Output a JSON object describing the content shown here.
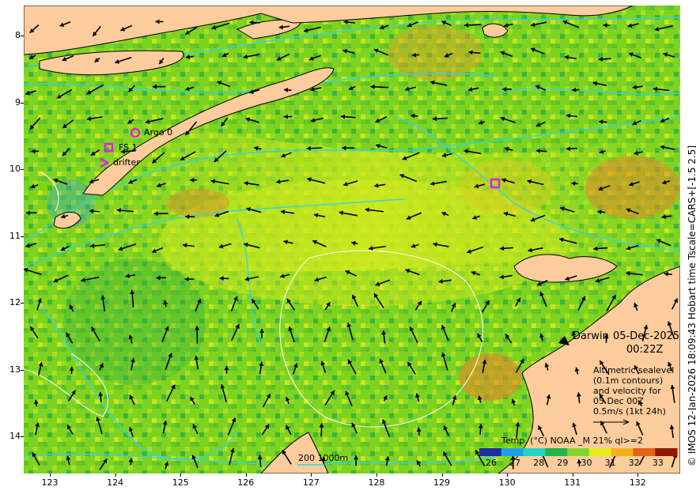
{
  "map": {
    "y_ticks": [
      "8",
      "9",
      "10",
      "11",
      "12",
      "13",
      "14"
    ],
    "y_values": [
      -8,
      -9,
      -10,
      -11,
      -12,
      -13,
      -14
    ],
    "x_ticks": [
      "123",
      "124",
      "125",
      "126",
      "127",
      "128",
      "129",
      "130",
      "131",
      "132"
    ],
    "x_values": [
      123,
      124,
      125,
      126,
      127,
      128,
      129,
      130,
      131,
      132
    ],
    "lon_range": [
      122.6,
      132.65
    ],
    "lat_range": [
      -7.55,
      -14.55
    ],
    "legend_items": [
      {
        "label": "Argo 0",
        "symbol": "circle"
      },
      {
        "label": "FS 1",
        "symbol": "square"
      },
      {
        "label": "drifter",
        "symbol": "chevron"
      }
    ],
    "place_label": "Darwin",
    "date_line1": "05-Dec-2025",
    "date_line2": "00:22Z",
    "info_lines": [
      "Altimetric sealevel",
      "(0.1m contours)",
      "and velocity for",
      "05 Dec 00Z",
      "0.5m/s (1kt 24h)"
    ],
    "colorbar_title": "Temp. (°C) NOAA _M 21% ql>=2",
    "colorbar_ticks": [
      "26",
      "27",
      "28",
      "29",
      "30",
      "31",
      "32",
      "33"
    ],
    "colorbar_range": [
      25.5,
      33.8
    ],
    "colorbar_colors": [
      "#1d2f9e",
      "#1ea0e6",
      "#27d3c4",
      "#21b34c",
      "#7fd72a",
      "#e7ec1d",
      "#f3b11e",
      "#e2641b",
      "#8f1a08"
    ],
    "scale_label": "200  1000m",
    "credit": "© IMOS 12-Jan-2026 18:09:43 Hobart time Tscale=CARS+[-1.5 2.5]",
    "colors": {
      "ocean": "#7ed321",
      "land": "#fdcc9c",
      "contour": "#2fd6e0",
      "sealevel": "#ffffff",
      "marker": "#e01ee6"
    }
  }
}
